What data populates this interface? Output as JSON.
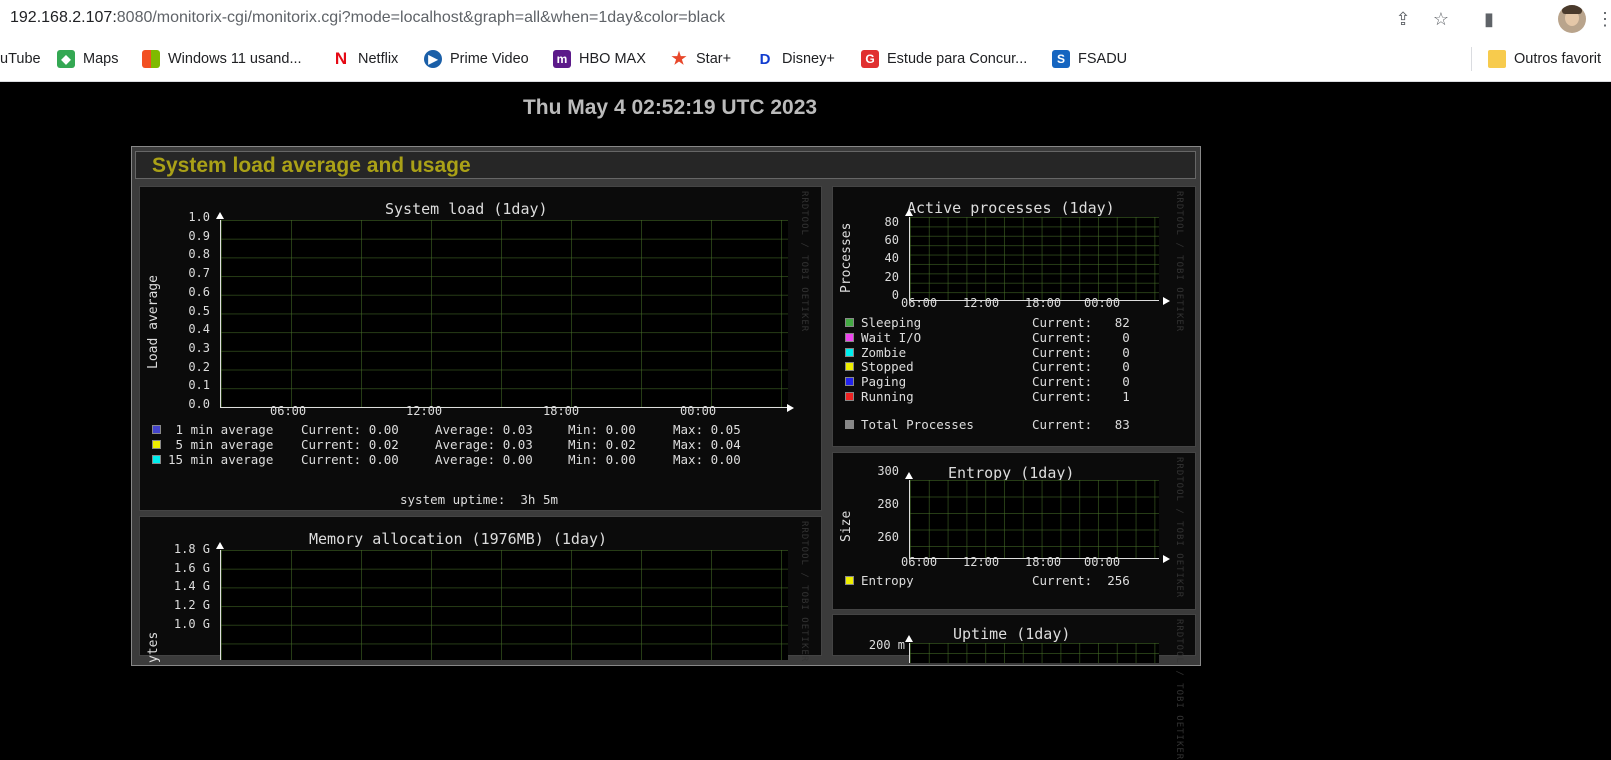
{
  "browser": {
    "url_host": "192.168.2.107:",
    "url_path": "8080/monitorix-cgi/monitorix.cgi?mode=localhost&graph=all&when=1day&color=black",
    "bookmarks": [
      {
        "label": "uTube",
        "icon": "youtube-icon"
      },
      {
        "label": "Maps",
        "icon": "maps-icon",
        "color": "#34a853"
      },
      {
        "label": "Windows 11 usand...",
        "icon": "windows-icon"
      },
      {
        "label": "Netflix",
        "icon": "netflix-icon",
        "color": "#e50914"
      },
      {
        "label": "Prime Video",
        "icon": "prime-video-icon",
        "color": "#1a98ff"
      },
      {
        "label": "HBO MAX",
        "icon": "hbo-max-icon",
        "color": "#5c1a8a"
      },
      {
        "label": "Star+",
        "icon": "star-plus-icon",
        "color": "#e8472a"
      },
      {
        "label": "Disney+",
        "icon": "disney-plus-icon",
        "color": "#113ccf"
      },
      {
        "label": "Estude para Concur...",
        "icon": "estude-icon",
        "color": "#e02f2f"
      },
      {
        "label": "FSADU",
        "icon": "fsadu-icon",
        "color": "#1565c0"
      },
      {
        "label": "Outros favorit",
        "icon": "folder-icon",
        "color": "#f7cb4d"
      }
    ]
  },
  "page": {
    "datetime": "Thu May 4 02:52:19 UTC 2023",
    "section_title": "System load average and usage"
  },
  "system_load": {
    "title": "System load  (1day)",
    "ylabel": "Load average",
    "yticks": [
      "1.0",
      "0.9",
      "0.8",
      "0.7",
      "0.6",
      "0.5",
      "0.4",
      "0.3",
      "0.2",
      "0.1",
      "0.0"
    ],
    "xticks": [
      "06:00",
      "12:00",
      "18:00",
      "00:00"
    ],
    "legend": [
      {
        "name": " 1 min average",
        "color": "#4444cc",
        "current": "Current: 0.00",
        "average": "Average: 0.03",
        "min": "Min: 0.00",
        "max": "Max: 0.05"
      },
      {
        "name": " 5 min average",
        "color": "#eeee00",
        "current": "Current: 0.02",
        "average": "Average: 0.03",
        "min": "Min: 0.02",
        "max": "Max: 0.04"
      },
      {
        "name": "15 min average",
        "color": "#00eeee",
        "current": "Current: 0.00",
        "average": "Average: 0.00",
        "min": "Min: 0.00",
        "max": "Max: 0.00"
      }
    ],
    "uptime": "system uptime:  3h 5m",
    "watermark": "RRDTOOL / TOBI OETIKER"
  },
  "memory": {
    "title": "Memory allocation (1976MB)  (1day)",
    "ylabel": "ytes",
    "yticks": [
      "1.8 G",
      "1.6 G",
      "1.4 G",
      "1.2 G",
      "1.0 G"
    ],
    "watermark": "RRDTOOL / TOBI OETIKER"
  },
  "processes": {
    "title": "Active processes  (1day)",
    "ylabel": "Processes",
    "yticks": [
      "80",
      "60",
      "40",
      "20",
      "0"
    ],
    "xticks": [
      "06:00",
      "12:00",
      "18:00",
      "00:00"
    ],
    "legend": [
      {
        "name": "Sleeping",
        "color": "#44aa44",
        "current": "Current:   82"
      },
      {
        "name": "Wait I/O",
        "color": "#ee44ee",
        "current": "Current:    0"
      },
      {
        "name": "Zombie",
        "color": "#00eeee",
        "current": "Current:    0"
      },
      {
        "name": "Stopped",
        "color": "#eeee00",
        "current": "Current:    0"
      },
      {
        "name": "Paging",
        "color": "#2222ee",
        "current": "Current:    0"
      },
      {
        "name": "Running",
        "color": "#ee2222",
        "current": "Current:    1"
      }
    ],
    "total": {
      "name": "Total Processes",
      "color": "#888888",
      "current": "Current:   83"
    },
    "watermark": "RRDTOOL / TOBI OETIKER"
  },
  "entropy": {
    "title": "Entropy  (1day)",
    "ylabel": "Size",
    "yticks": [
      "300",
      "280",
      "260"
    ],
    "xticks": [
      "06:00",
      "12:00",
      "18:00",
      "00:00"
    ],
    "legend": [
      {
        "name": "Entropy",
        "color": "#eeee00",
        "current": "Current:  256"
      }
    ],
    "watermark": "RRDTOOL / TOBI OETIKER"
  },
  "uptime_graph": {
    "title": "Uptime  (1day)",
    "yticks": [
      "200 m"
    ],
    "watermark": "RRDTOOL / TOBI OETIKER"
  },
  "chart_data": [
    {
      "type": "line",
      "title": "System load  (1day)",
      "ylabel": "Load average",
      "ylim": [
        0,
        1.0
      ],
      "categories": [
        "06:00",
        "12:00",
        "18:00",
        "00:00"
      ],
      "series": [
        {
          "name": "1 min average",
          "values": []
        },
        {
          "name": "5 min average",
          "values": []
        },
        {
          "name": "15 min average",
          "values": []
        }
      ]
    },
    {
      "type": "area",
      "title": "Active processes  (1day)",
      "ylabel": "Processes",
      "ylim": [
        0,
        80
      ],
      "categories": [
        "06:00",
        "12:00",
        "18:00",
        "00:00"
      ]
    },
    {
      "type": "line",
      "title": "Entropy  (1day)",
      "ylabel": "Size",
      "ylim": [
        260,
        300
      ],
      "categories": [
        "06:00",
        "12:00",
        "18:00",
        "00:00"
      ]
    }
  ]
}
